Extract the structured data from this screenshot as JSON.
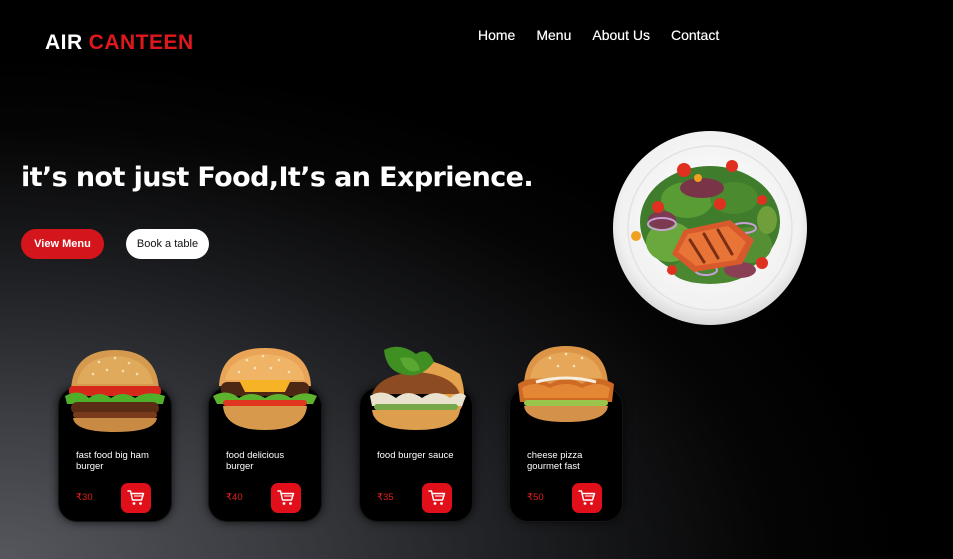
{
  "brand": {
    "part1": "AIR",
    "part2": "CANTEEN"
  },
  "nav": [
    "Home",
    "Menu",
    "About Us",
    "Contact"
  ],
  "hero": {
    "title": "it’s not just Food,It’s an Exprience.",
    "primary_button": "View Menu",
    "secondary_button": "Book a table"
  },
  "products": [
    {
      "name": "fast food big ham burger",
      "price": "₹30",
      "image": "burger-icon"
    },
    {
      "name": "food delicious burger",
      "price": "₹40",
      "image": "burger-icon"
    },
    {
      "name": "food burger sauce",
      "price": "₹35",
      "image": "burger-icon"
    },
    {
      "name": "cheese pizza gourmet fast",
      "price": "₹50",
      "image": "chicken-burger-icon"
    }
  ],
  "colors": {
    "accent": "#d4151b",
    "background": "#000000",
    "card": "#000000",
    "price": "#e3201f"
  },
  "icons": [
    "salad-plate-icon",
    "burger-icon",
    "cart-icon"
  ]
}
